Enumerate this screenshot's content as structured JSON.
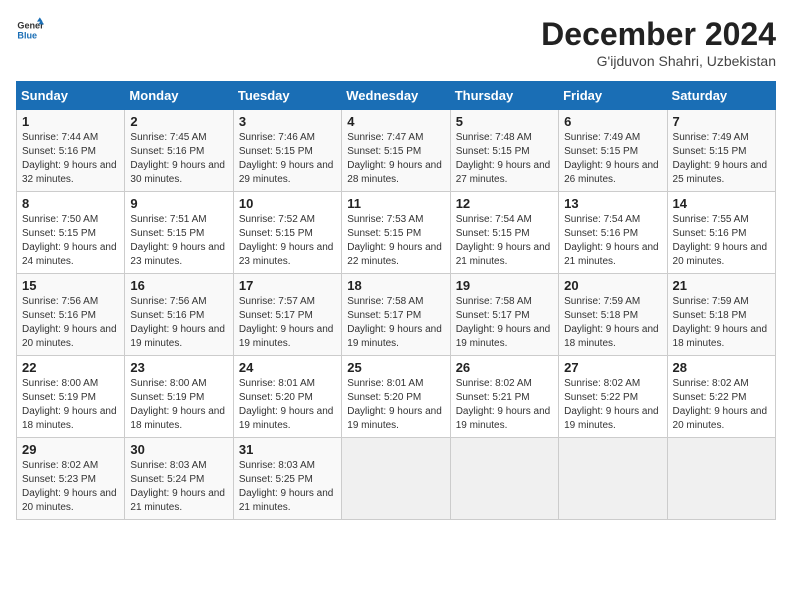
{
  "header": {
    "logo_line1": "General",
    "logo_line2": "Blue",
    "month_title": "December 2024",
    "subtitle": "G'ijduvon Shahri, Uzbekistan"
  },
  "weekdays": [
    "Sunday",
    "Monday",
    "Tuesday",
    "Wednesday",
    "Thursday",
    "Friday",
    "Saturday"
  ],
  "weeks": [
    [
      {
        "day": "1",
        "sunrise": "7:44 AM",
        "sunset": "5:16 PM",
        "daylight": "9 hours and 32 minutes."
      },
      {
        "day": "2",
        "sunrise": "7:45 AM",
        "sunset": "5:16 PM",
        "daylight": "9 hours and 30 minutes."
      },
      {
        "day": "3",
        "sunrise": "7:46 AM",
        "sunset": "5:15 PM",
        "daylight": "9 hours and 29 minutes."
      },
      {
        "day": "4",
        "sunrise": "7:47 AM",
        "sunset": "5:15 PM",
        "daylight": "9 hours and 28 minutes."
      },
      {
        "day": "5",
        "sunrise": "7:48 AM",
        "sunset": "5:15 PM",
        "daylight": "9 hours and 27 minutes."
      },
      {
        "day": "6",
        "sunrise": "7:49 AM",
        "sunset": "5:15 PM",
        "daylight": "9 hours and 26 minutes."
      },
      {
        "day": "7",
        "sunrise": "7:49 AM",
        "sunset": "5:15 PM",
        "daylight": "9 hours and 25 minutes."
      }
    ],
    [
      {
        "day": "8",
        "sunrise": "7:50 AM",
        "sunset": "5:15 PM",
        "daylight": "9 hours and 24 minutes."
      },
      {
        "day": "9",
        "sunrise": "7:51 AM",
        "sunset": "5:15 PM",
        "daylight": "9 hours and 23 minutes."
      },
      {
        "day": "10",
        "sunrise": "7:52 AM",
        "sunset": "5:15 PM",
        "daylight": "9 hours and 23 minutes."
      },
      {
        "day": "11",
        "sunrise": "7:53 AM",
        "sunset": "5:15 PM",
        "daylight": "9 hours and 22 minutes."
      },
      {
        "day": "12",
        "sunrise": "7:54 AM",
        "sunset": "5:15 PM",
        "daylight": "9 hours and 21 minutes."
      },
      {
        "day": "13",
        "sunrise": "7:54 AM",
        "sunset": "5:16 PM",
        "daylight": "9 hours and 21 minutes."
      },
      {
        "day": "14",
        "sunrise": "7:55 AM",
        "sunset": "5:16 PM",
        "daylight": "9 hours and 20 minutes."
      }
    ],
    [
      {
        "day": "15",
        "sunrise": "7:56 AM",
        "sunset": "5:16 PM",
        "daylight": "9 hours and 20 minutes."
      },
      {
        "day": "16",
        "sunrise": "7:56 AM",
        "sunset": "5:16 PM",
        "daylight": "9 hours and 19 minutes."
      },
      {
        "day": "17",
        "sunrise": "7:57 AM",
        "sunset": "5:17 PM",
        "daylight": "9 hours and 19 minutes."
      },
      {
        "day": "18",
        "sunrise": "7:58 AM",
        "sunset": "5:17 PM",
        "daylight": "9 hours and 19 minutes."
      },
      {
        "day": "19",
        "sunrise": "7:58 AM",
        "sunset": "5:17 PM",
        "daylight": "9 hours and 19 minutes."
      },
      {
        "day": "20",
        "sunrise": "7:59 AM",
        "sunset": "5:18 PM",
        "daylight": "9 hours and 18 minutes."
      },
      {
        "day": "21",
        "sunrise": "7:59 AM",
        "sunset": "5:18 PM",
        "daylight": "9 hours and 18 minutes."
      }
    ],
    [
      {
        "day": "22",
        "sunrise": "8:00 AM",
        "sunset": "5:19 PM",
        "daylight": "9 hours and 18 minutes."
      },
      {
        "day": "23",
        "sunrise": "8:00 AM",
        "sunset": "5:19 PM",
        "daylight": "9 hours and 18 minutes."
      },
      {
        "day": "24",
        "sunrise": "8:01 AM",
        "sunset": "5:20 PM",
        "daylight": "9 hours and 19 minutes."
      },
      {
        "day": "25",
        "sunrise": "8:01 AM",
        "sunset": "5:20 PM",
        "daylight": "9 hours and 19 minutes."
      },
      {
        "day": "26",
        "sunrise": "8:02 AM",
        "sunset": "5:21 PM",
        "daylight": "9 hours and 19 minutes."
      },
      {
        "day": "27",
        "sunrise": "8:02 AM",
        "sunset": "5:22 PM",
        "daylight": "9 hours and 19 minutes."
      },
      {
        "day": "28",
        "sunrise": "8:02 AM",
        "sunset": "5:22 PM",
        "daylight": "9 hours and 20 minutes."
      }
    ],
    [
      {
        "day": "29",
        "sunrise": "8:02 AM",
        "sunset": "5:23 PM",
        "daylight": "9 hours and 20 minutes."
      },
      {
        "day": "30",
        "sunrise": "8:03 AM",
        "sunset": "5:24 PM",
        "daylight": "9 hours and 21 minutes."
      },
      {
        "day": "31",
        "sunrise": "8:03 AM",
        "sunset": "5:25 PM",
        "daylight": "9 hours and 21 minutes."
      },
      null,
      null,
      null,
      null
    ]
  ]
}
